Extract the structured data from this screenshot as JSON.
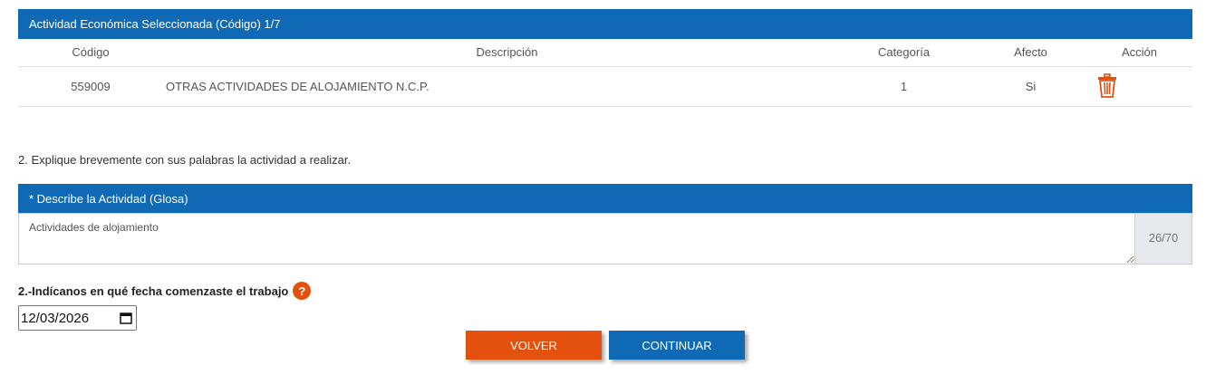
{
  "activities": {
    "header": "Actividad Económica Seleccionada (Código) 1/7",
    "columns": {
      "codigo": "Código",
      "descripcion": "Descripción",
      "categoria": "Categoría",
      "afecto": "Afecto",
      "accion": "Acción"
    },
    "rows": [
      {
        "codigo": "559009",
        "descripcion": "OTRAS ACTIVIDADES DE ALOJAMIENTO N.C.P.",
        "categoria": "1",
        "afecto": "Si",
        "action_icon": "trash-icon"
      }
    ]
  },
  "question_2": "2. Explique brevemente con sus palabras la actividad a realizar.",
  "glosa": {
    "header": "* Describe la Actividad (Glosa)",
    "value": "Actividades de alojamiento",
    "counter": "26/70"
  },
  "date_question": {
    "label": "2.-Indícanos en qué fecha comenzaste el trabajo",
    "help_symbol": "?",
    "date_value": "12/03/2026",
    "calendar_icon": "calendar-icon"
  },
  "buttons": {
    "volver": "VOLVER",
    "continuar": "CONTINUAR"
  },
  "colors": {
    "primary_blue": "#0f69b4",
    "accent_orange": "#e4500e"
  }
}
